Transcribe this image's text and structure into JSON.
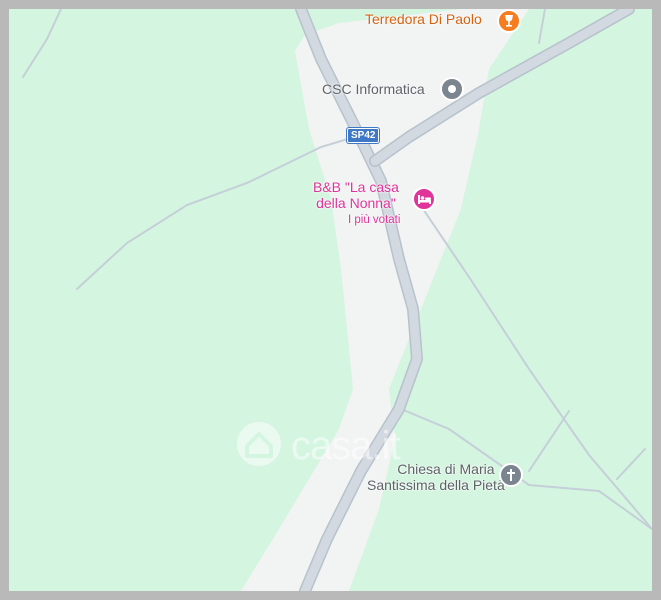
{
  "map": {
    "colors": {
      "background": "#d4f5e0",
      "urban_area": "#f2f3f3",
      "road_fill": "#d2d9e0",
      "road_edge": "#b7c2cc",
      "minor_road": "#c5cfd8",
      "food_marker": "#f57c1f",
      "poi_marker": "#7b8590",
      "hotel_marker": "#e0349b",
      "route_shield": "#3f79c6"
    },
    "route_shield": "SP42",
    "pois": [
      {
        "name": "Terredora Di Paolo",
        "icon": "wine-glass-icon",
        "category": "food"
      },
      {
        "name": "CSC Informatica",
        "icon": "generic-place-icon",
        "category": "place"
      },
      {
        "name_line1": "B&B \"La casa",
        "name_line2": "della Nonna\"",
        "subtitle": "I più votati",
        "icon": "bed-icon",
        "category": "hotel"
      },
      {
        "name_line1": "Chiesa di Maria",
        "name_line2": "Santissima della Pietà",
        "icon": "church-cross-icon",
        "category": "church"
      }
    ],
    "watermark": "casa.it"
  }
}
